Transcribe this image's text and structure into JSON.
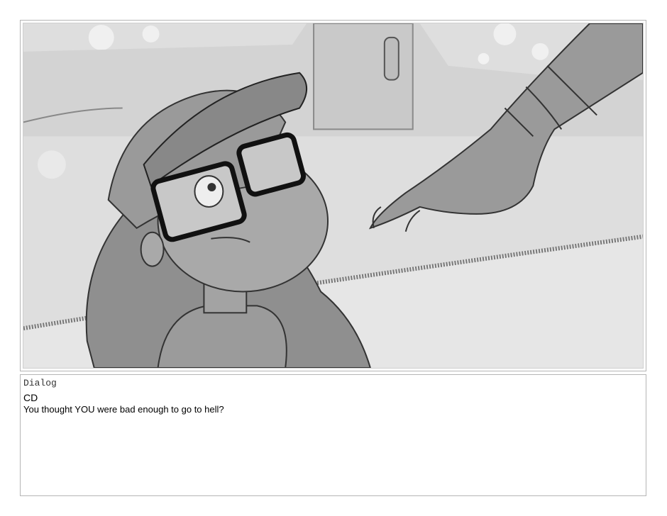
{
  "storyboard_panel": {
    "image_description_icon": "sketch-panel-image"
  },
  "dialog": {
    "heading": "Dialog",
    "speaker": "CD",
    "line": "You thought YOU were bad enough to go to hell?"
  }
}
